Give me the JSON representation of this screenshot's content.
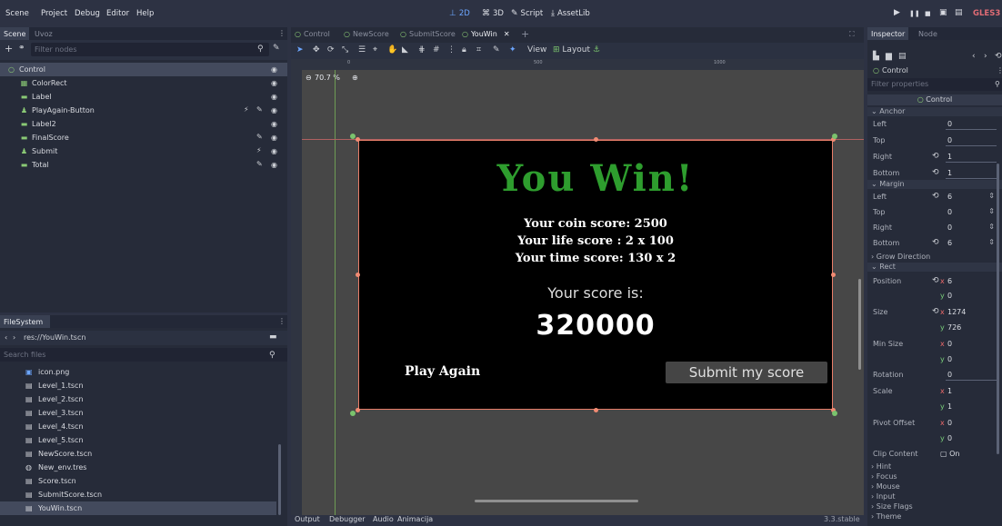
{
  "menubar": {
    "items": [
      "Scene",
      "Project",
      "Debug",
      "Editor",
      "Help"
    ],
    "workspaces": {
      "twod": "2D",
      "threed": "3D",
      "script": "Script",
      "assetlib": "AssetLib"
    },
    "renderer": "GLES3"
  },
  "scene_dock": {
    "tabs": [
      "Scene",
      "Uvoz"
    ],
    "filter_placeholder": "Filter nodes",
    "nodes": [
      {
        "name": "Control",
        "icon": "control-node-icon"
      },
      {
        "name": "ColorRect",
        "icon": "colorrect-node-icon"
      },
      {
        "name": "Label",
        "icon": "label-node-icon"
      },
      {
        "name": "PlayAgain-Button",
        "icon": "button-node-icon"
      },
      {
        "name": "Label2",
        "icon": "label-node-icon"
      },
      {
        "name": "FinalScore",
        "icon": "label-node-icon"
      },
      {
        "name": "Submit",
        "icon": "button-node-icon"
      },
      {
        "name": "Total",
        "icon": "label-node-icon"
      }
    ]
  },
  "filesystem": {
    "tab": "FileSystem",
    "path": "res://YouWin.tscn",
    "search_placeholder": "Search files",
    "files": [
      "icon.png",
      "Level_1.tscn",
      "Level_2.tscn",
      "Level_3.tscn",
      "Level_4.tscn",
      "Level_5.tscn",
      "NewScore.tscn",
      "New_env.tres",
      "Score.tscn",
      "SubmitScore.tscn",
      "YouWin.tscn"
    ],
    "selected": "YouWin.tscn"
  },
  "center": {
    "tabs": [
      "Control",
      "NewScore",
      "SubmitScore",
      "YouWin"
    ],
    "active_tab": "YouWin",
    "toolbar": {
      "view": "View",
      "layout": "Layout"
    },
    "zoom": "70.7 %",
    "ruler_marks": [
      "0",
      "500",
      "1000"
    ],
    "bottom_tabs": [
      "Output",
      "Debugger",
      "Audio",
      "Animacija"
    ],
    "version": "3.3.stable"
  },
  "game": {
    "title": "You Win!",
    "coin": "Your coin score: 2500",
    "life": "Your life score : 2 x 100",
    "time": "Your time score: 130 x 2",
    "score_label": "Your score is:",
    "final_score": "320000",
    "play_again": "Play Again",
    "submit": "Submit my score"
  },
  "inspector": {
    "tabs": [
      "Inspector",
      "Node"
    ],
    "object": "Control",
    "filter_placeholder": "Filter properties",
    "class_header": "Control",
    "sections": {
      "anchor": "Anchor",
      "margin": "Margin",
      "grow": "Grow Direction",
      "rect": "Rect",
      "hint": "Hint",
      "focus": "Focus",
      "mouse": "Mouse",
      "input": "Input",
      "size_flags": "Size Flags",
      "theme": "Theme"
    },
    "anchor": {
      "left": "0",
      "top": "0",
      "right": "1",
      "bottom": "1"
    },
    "margin": {
      "left": "6",
      "top": "0",
      "right": "0",
      "bottom": "6"
    },
    "labels": {
      "left": "Left",
      "top": "Top",
      "right": "Right",
      "bottom": "Bottom",
      "position": "Position",
      "size": "Size",
      "min_size": "Min Size",
      "rotation": "Rotation",
      "scale": "Scale",
      "pivot": "Pivot Offset",
      "clip": "Clip Content",
      "on": "On"
    },
    "rect": {
      "pos_x": "6",
      "pos_y": "0",
      "size_x": "1274",
      "size_y": "726",
      "min_x": "0",
      "min_y": "0",
      "rotation": "0",
      "scale_x": "1",
      "scale_y": "1",
      "pivot_x": "0",
      "pivot_y": "0"
    }
  },
  "colors": {
    "accent": "#6ca6ff",
    "win_green": "#2e9d2e",
    "selection_border": "#e87e69"
  }
}
